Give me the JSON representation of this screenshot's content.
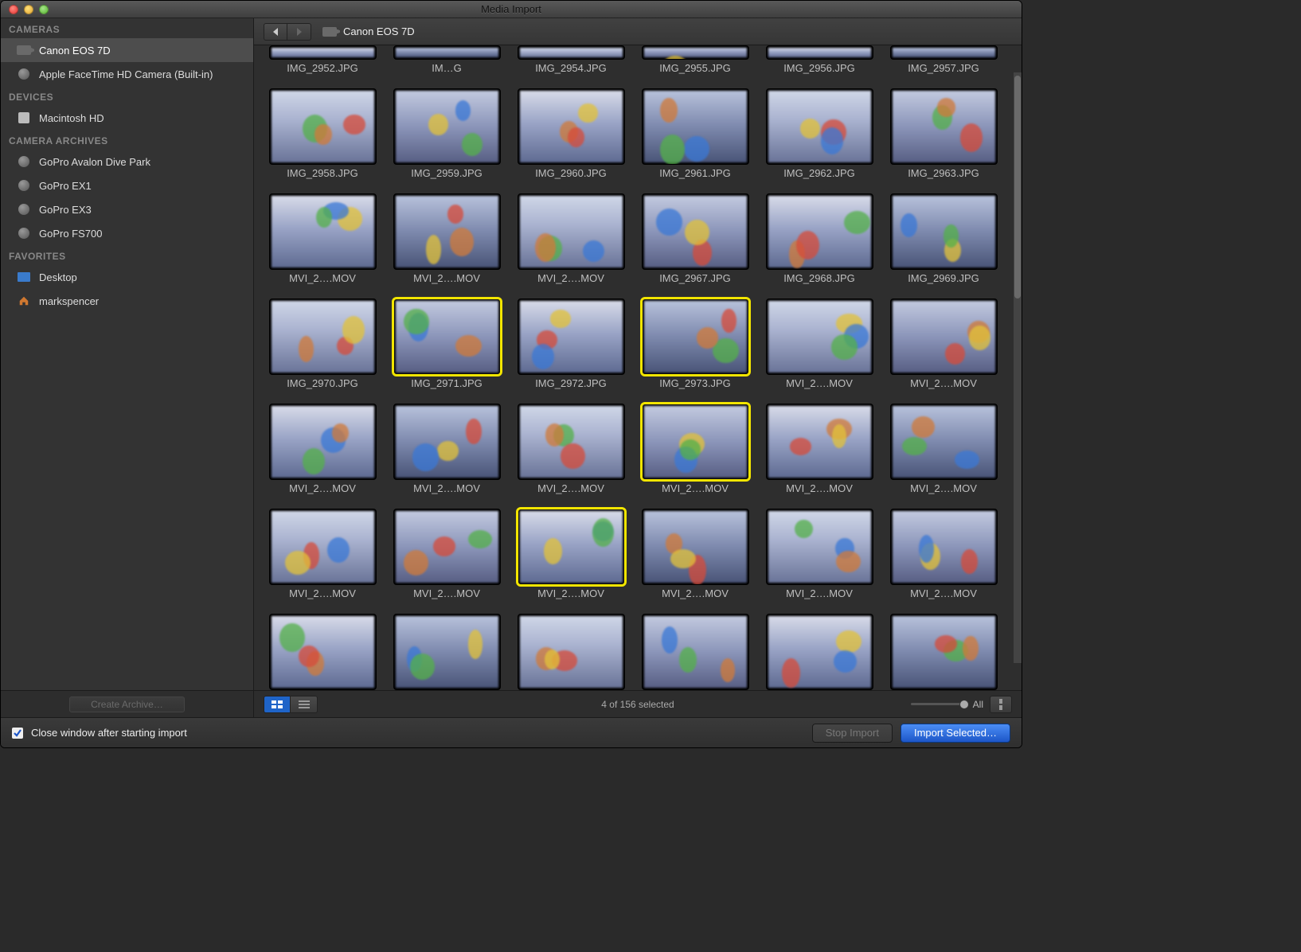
{
  "window": {
    "title": "Media Import"
  },
  "sidebar": {
    "sections": [
      {
        "header": "CAMERAS",
        "items": [
          {
            "label": "Canon EOS 7D",
            "icon": "camera",
            "selected": true
          },
          {
            "label": "Apple FaceTime HD Camera (Built-in)",
            "icon": "dot"
          }
        ]
      },
      {
        "header": "DEVICES",
        "items": [
          {
            "label": "Macintosh HD",
            "icon": "disk"
          }
        ]
      },
      {
        "header": "CAMERA ARCHIVES",
        "items": [
          {
            "label": "GoPro Avalon Dive Park",
            "icon": "dot"
          },
          {
            "label": "GoPro EX1",
            "icon": "dot"
          },
          {
            "label": "GoPro EX3",
            "icon": "dot"
          },
          {
            "label": "GoPro FS700",
            "icon": "dot"
          }
        ]
      },
      {
        "header": "FAVORITES",
        "items": [
          {
            "label": "Desktop",
            "icon": "folder"
          },
          {
            "label": "markspencer",
            "icon": "home"
          }
        ]
      }
    ],
    "footer_button": "Create Archive…"
  },
  "toolbar": {
    "path": "Canon EOS 7D"
  },
  "thumbnails": [
    {
      "label": "IMG_2952.JPG"
    },
    {
      "label": "IM…G"
    },
    {
      "label": "IMG_2954.JPG"
    },
    {
      "label": "IMG_2955.JPG"
    },
    {
      "label": "IMG_2956.JPG"
    },
    {
      "label": "IMG_2957.JPG"
    },
    {
      "label": "IMG_2958.JPG"
    },
    {
      "label": "IMG_2959.JPG"
    },
    {
      "label": "IMG_2960.JPG"
    },
    {
      "label": "IMG_2961.JPG"
    },
    {
      "label": "IMG_2962.JPG"
    },
    {
      "label": "IMG_2963.JPG"
    },
    {
      "label": "MVI_2….MOV"
    },
    {
      "label": "MVI_2….MOV"
    },
    {
      "label": "MVI_2….MOV"
    },
    {
      "label": "IMG_2967.JPG"
    },
    {
      "label": "IMG_2968.JPG"
    },
    {
      "label": "IMG_2969.JPG"
    },
    {
      "label": "IMG_2970.JPG"
    },
    {
      "label": "IMG_2971.JPG",
      "selected": true
    },
    {
      "label": "IMG_2972.JPG"
    },
    {
      "label": "IMG_2973.JPG",
      "selected": true
    },
    {
      "label": "MVI_2….MOV"
    },
    {
      "label": "MVI_2….MOV"
    },
    {
      "label": "MVI_2….MOV"
    },
    {
      "label": "MVI_2….MOV"
    },
    {
      "label": "MVI_2….MOV"
    },
    {
      "label": "MVI_2….MOV",
      "selected": true
    },
    {
      "label": "MVI_2….MOV"
    },
    {
      "label": "MVI_2….MOV"
    },
    {
      "label": "MVI_2….MOV"
    },
    {
      "label": "MVI_2….MOV"
    },
    {
      "label": "MVI_2….MOV",
      "selected": true
    },
    {
      "label": "MVI_2….MOV"
    },
    {
      "label": "MVI_2….MOV"
    },
    {
      "label": "MVI_2….MOV"
    },
    {
      "label": ""
    },
    {
      "label": ""
    },
    {
      "label": ""
    },
    {
      "label": ""
    },
    {
      "label": ""
    },
    {
      "label": ""
    }
  ],
  "status": {
    "selection_text": "4 of 156 selected",
    "size_label": "All"
  },
  "bottom": {
    "close_checkbox_label": "Close window after starting import",
    "close_checked": true,
    "stop_label": "Stop Import",
    "import_label": "Import Selected…"
  }
}
